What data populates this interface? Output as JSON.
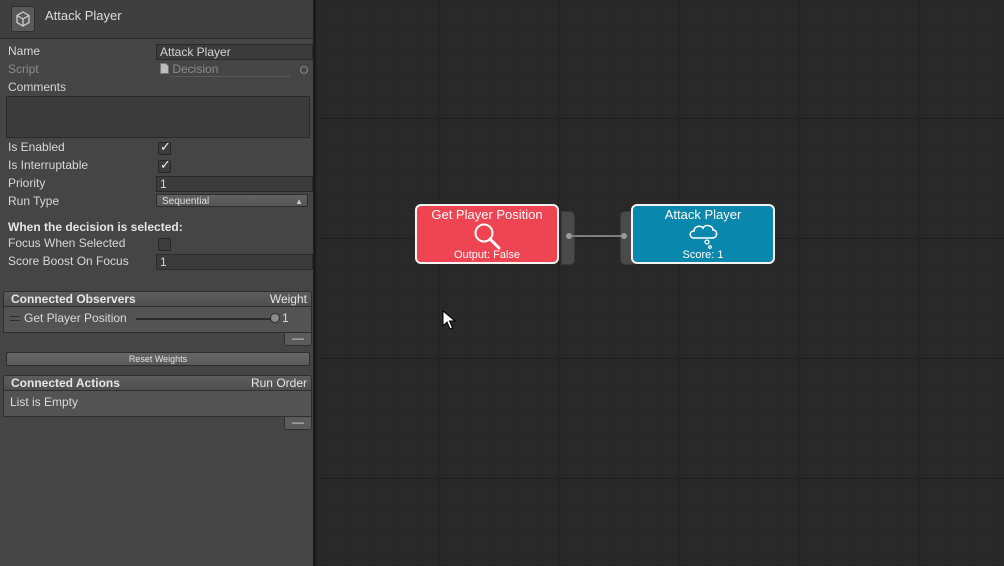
{
  "inspector": {
    "title": "Attack Player",
    "fields": {
      "name_label": "Name",
      "name_value": "Attack Player",
      "script_label": "Script",
      "script_value": "Decision",
      "comments_label": "Comments",
      "is_enabled_label": "Is Enabled",
      "is_enabled": true,
      "is_interruptable_label": "Is Interruptable",
      "is_interruptable": true,
      "priority_label": "Priority",
      "priority_value": "1",
      "run_type_label": "Run Type",
      "run_type_value": "Sequential"
    },
    "selected_section": {
      "heading": "When the decision is selected:",
      "focus_label": "Focus When Selected",
      "focus_checked": false,
      "score_boost_label": "Score Boost On Focus",
      "score_boost_value": "1"
    },
    "observers": {
      "header": "Connected Observers",
      "right_header": "Weight",
      "items": [
        {
          "name": "Get Player Position",
          "weight": "1",
          "weight_fraction": 1.0
        }
      ],
      "minus_label": "—",
      "reset_label": "Reset Weights"
    },
    "actions": {
      "header": "Connected Actions",
      "right_header": "Run Order",
      "empty_text": "List is Empty",
      "minus_label": "—"
    }
  },
  "canvas": {
    "nodes": [
      {
        "title": "Get Player Position",
        "subtitle": "Output: False",
        "icon": "magnifier-icon",
        "color": "#ef4451"
      },
      {
        "title": "Attack Player",
        "subtitle": "Score: 1",
        "icon": "thought-bubble-icon",
        "color": "#0a87ac"
      }
    ]
  }
}
